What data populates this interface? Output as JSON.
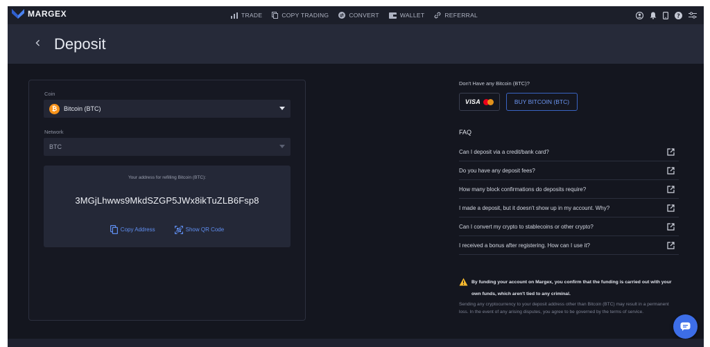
{
  "brand": {
    "name": "MARGEX",
    "accent": "#5f8ef0",
    "logo_color": "#4a82f0"
  },
  "nav": {
    "items": [
      {
        "label": "TRADE",
        "icon": "bar-chart-icon"
      },
      {
        "label": "COPY TRADING",
        "icon": "copy-icon"
      },
      {
        "label": "CONVERT",
        "icon": "convert-icon"
      },
      {
        "label": "WALLET",
        "icon": "wallet-icon"
      },
      {
        "label": "REFERRAL",
        "icon": "link-icon"
      }
    ],
    "right_icons": [
      "user-icon",
      "bell-icon",
      "phone-icon",
      "help-icon",
      "settings-icon"
    ]
  },
  "header": {
    "back_icon": "chevron-left-icon",
    "title": "Deposit"
  },
  "deposit": {
    "coin_label": "Coin",
    "coin_value": "Bitcoin (BTC)",
    "coin_icon_glyph": "₿",
    "network_label": "Network",
    "network_value": "BTC",
    "address_caption": "Your address for refilling Bitcoin (BTC):",
    "address": "3MGjLhwws9MkdSZGP5JWx8ikTuZLB6Fsp8",
    "copy_label": "Copy Address",
    "qr_label": "Show QR Code"
  },
  "purchase": {
    "prompt": "Don't Have any Bitcoin (BTC)?",
    "visa_label": "VISA",
    "buy_label": "BUY BITCOIN (BTC)"
  },
  "faq": {
    "title": "FAQ",
    "items": [
      "Can I deposit via a credit/bank card?",
      "Do you have any deposit fees?",
      "How many block confirmations do deposits require?",
      "I made a deposit, but it doesn't show up in my account. Why?",
      "Can I convert my crypto to stablecoins or other crypto?",
      "I received a bonus after registering. How can I use it?"
    ]
  },
  "warning": {
    "strong": "By funding your account on Margex, you confirm that the funding is carried out with your own funds, which aren't tied to any criminal.",
    "small": "Sending any cryptocurrency to your deposit address other than Bitcoin (BTC) may result in a permanent loss. In the event of any arising disputes, you agree to be governed by the terms of service."
  }
}
